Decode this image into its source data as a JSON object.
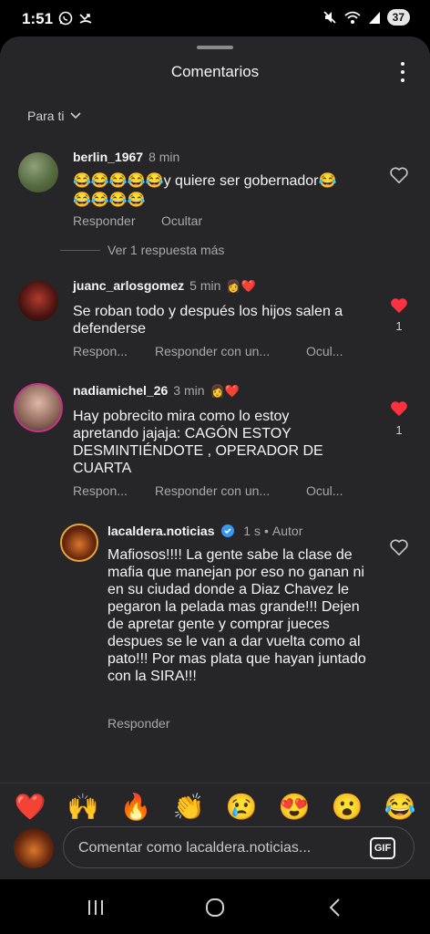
{
  "status_bar": {
    "time": "1:51",
    "battery": "37"
  },
  "sheet": {
    "title": "Comentarios",
    "sort_label": "Para ti"
  },
  "comments": [
    {
      "user": "berlin_1967",
      "time": "8 min",
      "text_line1": "😂😂😂😂😂y quiere ser gobernador😂",
      "text_line2": "😂😂😂😂",
      "actions": [
        "Responder",
        "Ocultar"
      ],
      "liked": false
    },
    {
      "user": "juanc_arlosgomez",
      "time": "5 min",
      "badge": "👩‍❤️",
      "text": "Se roban todo y después los hijos salen a defenderse",
      "actions": [
        "Respon...",
        "Responder con un...",
        "Ocul..."
      ],
      "liked": true,
      "likes": "1"
    },
    {
      "user": "nadiamichel_26",
      "time": "3 min",
      "text": "Hay pobrecito mira como lo estoy apretando jajaja: CAGÓN ESTOY DESMINTIÉNDOTE , OPERADOR DE CUARTA",
      "actions": [
        "Respon...",
        "Responder con un...",
        "Ocul..."
      ],
      "liked": true,
      "likes": "1"
    }
  ],
  "view_replies": "Ver 1 respuesta más",
  "reply": {
    "user": "lacaldera.noticias",
    "time": "1 s",
    "author_label": "Autor",
    "text": "Mafiosos!!!! La gente sabe la clase de mafia que manejan por eso no ganan ni en su ciudad donde a Diaz Chavez le pegaron la pelada mas grande!!! Dejen de apretar gente y comprar jueces despues se le van a dar vuelta como al pato!!! Por mas plata que hayan juntado con la SIRA!!!",
    "action": "Responder",
    "liked": false
  },
  "emoji_bar": [
    "❤️",
    "🙌",
    "🔥",
    "👏",
    "😢",
    "😍",
    "😮",
    "😂"
  ],
  "composer": {
    "placeholder": "Comentar como lacaldera.noticias...",
    "gif_label": "GIF"
  },
  "colors": {
    "sheet_bg": "#262629",
    "like_red": "#ff3040",
    "verified_blue": "#3897f0"
  }
}
